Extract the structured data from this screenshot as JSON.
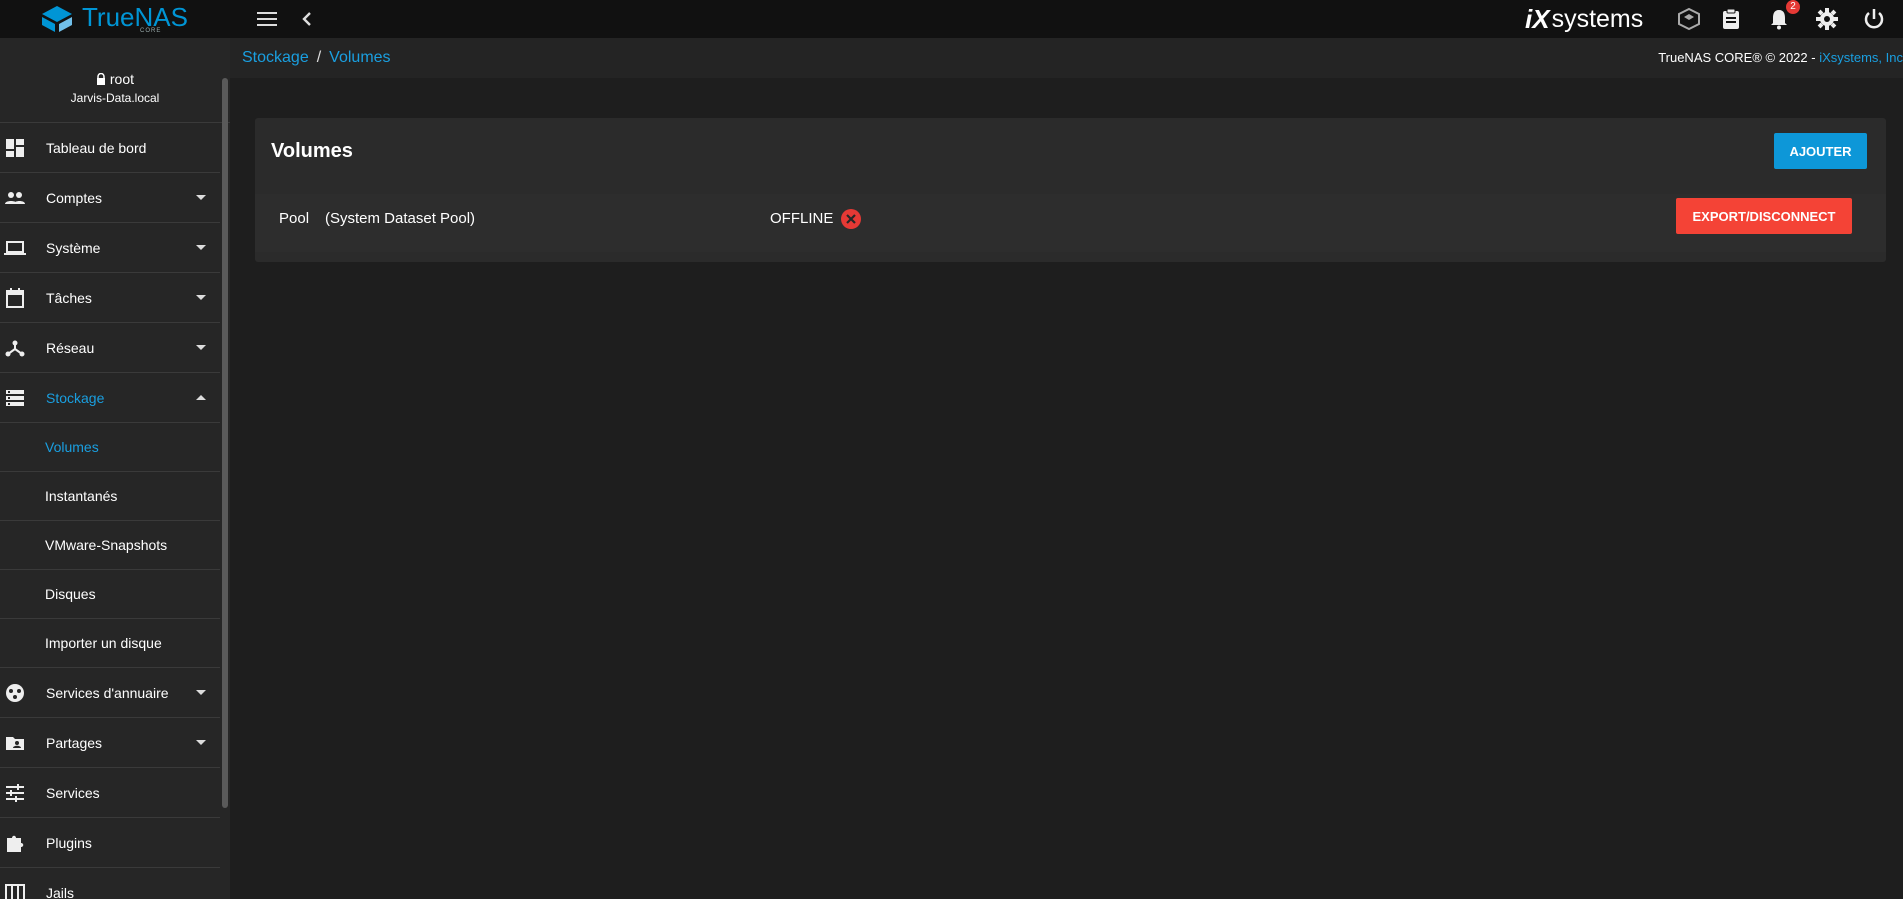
{
  "topbar": {
    "brand": "TrueNAS",
    "brand_sub": "CORE",
    "vendor_i": "iX",
    "vendor_name": "systems",
    "notifications_count": "2",
    "icons": [
      "menu-icon",
      "chevron-left-icon",
      "truecommand-icon",
      "clipboard-icon",
      "bell-icon",
      "gear-icon",
      "power-icon"
    ]
  },
  "user": {
    "name": "root",
    "host": "Jarvis-Data.local"
  },
  "sidebar": {
    "items": [
      {
        "label": "Tableau de bord"
      },
      {
        "label": "Comptes"
      },
      {
        "label": "Système"
      },
      {
        "label": "Tâches"
      },
      {
        "label": "Réseau"
      },
      {
        "label": "Stockage"
      },
      {
        "label": "Services d'annuaire"
      },
      {
        "label": "Partages"
      },
      {
        "label": "Services"
      },
      {
        "label": "Plugins"
      },
      {
        "label": "Jails"
      }
    ],
    "storage_sub": [
      {
        "label": "Volumes"
      },
      {
        "label": "Instantanés"
      },
      {
        "label": "VMware-Snapshots"
      },
      {
        "label": "Disques"
      },
      {
        "label": "Importer un disque"
      }
    ]
  },
  "breadcrumb": {
    "parent": "Stockage",
    "sep": "/",
    "current": "Volumes"
  },
  "copyright": {
    "text": "TrueNAS CORE® © 2022 - ",
    "link": "iXsystems, Inc"
  },
  "main": {
    "title": "Volumes",
    "add_label": "AJOUTER",
    "pool": {
      "name": "Pool",
      "desc": "(System Dataset Pool)",
      "status": "OFFLINE",
      "export_label": "EXPORT/DISCONNECT"
    }
  },
  "colors": {
    "accent": "#1a9fe0",
    "danger": "#f44336",
    "primary_button": "#0d97d8"
  }
}
